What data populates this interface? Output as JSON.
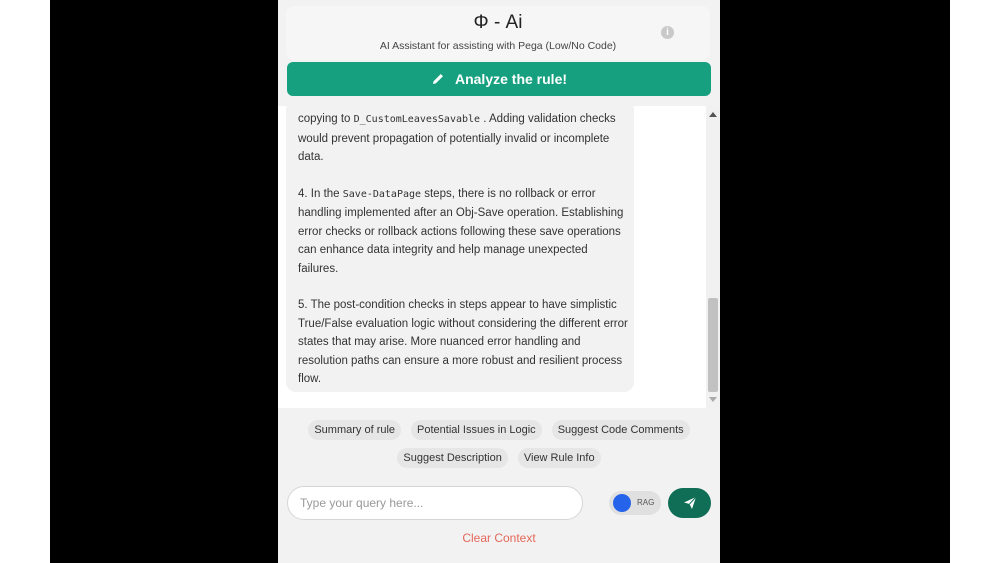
{
  "header": {
    "title": "Φ - Ai",
    "subtitle": "AI Assistant for assisting with Pega (Low/No Code)",
    "info_icon": "info-icon"
  },
  "analyze_button": {
    "label": "Analyze the rule!",
    "icon": "pencil-icon",
    "color": "#16a07f"
  },
  "message": {
    "p1_before": "copying to ",
    "p1_code": "D_CustomLeavesSavable",
    "p1_after": " . Adding validation checks would prevent propagation of potentially invalid or incomplete data.",
    "p2_before": "4. In the ",
    "p2_code": "Save-DataPage",
    "p2_after": " steps, there is no rollback or error handling implemented after an Obj-Save operation. Establishing error checks or rollback actions following these save operations can enhance data integrity and help manage unexpected failures.",
    "p3": "5. The post-condition checks in steps appear to have simplistic True/False evaluation logic without considering the different error states that may arise. More nuanced error handling and resolution paths can ensure a more robust and resilient process flow."
  },
  "suggestions": {
    "row1": [
      "Summary of rule",
      "Potential Issues in Logic",
      "Suggest Code Comments"
    ],
    "row2": [
      "Suggest Description",
      "View Rule Info"
    ]
  },
  "query": {
    "placeholder": "Type your query here...",
    "value": ""
  },
  "rag": {
    "label": "RAG",
    "knob_color": "#2563eb"
  },
  "send_button": {
    "icon": "send-icon",
    "color": "#0f6e55"
  },
  "clear_context": {
    "label": "Clear Context",
    "color": "#e4685a"
  }
}
